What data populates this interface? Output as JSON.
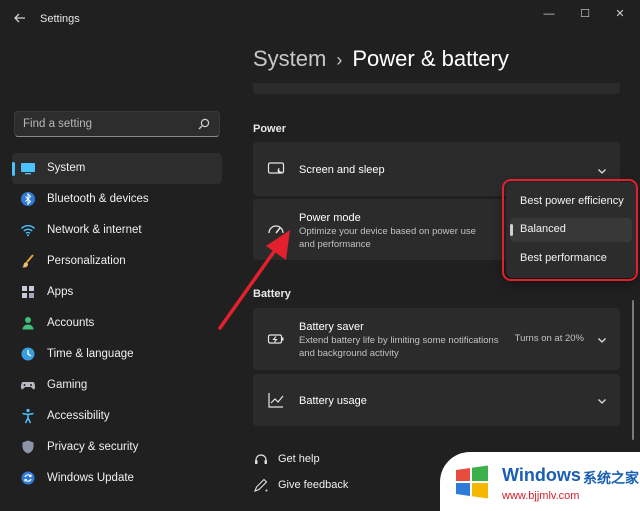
{
  "window": {
    "app_title": "Settings",
    "controls": {
      "minimize": "—",
      "maximize": "☐",
      "close": "✕"
    }
  },
  "search": {
    "placeholder": "Find a setting"
  },
  "sidebar": {
    "items": [
      {
        "label": "System",
        "icon": "monitor-icon",
        "selected": true
      },
      {
        "label": "Bluetooth & devices",
        "icon": "bluetooth-icon"
      },
      {
        "label": "Network & internet",
        "icon": "wifi-icon"
      },
      {
        "label": "Personalization",
        "icon": "brush-icon"
      },
      {
        "label": "Apps",
        "icon": "apps-grid-icon"
      },
      {
        "label": "Accounts",
        "icon": "person-icon"
      },
      {
        "label": "Time & language",
        "icon": "globe-clock-icon"
      },
      {
        "label": "Gaming",
        "icon": "gamepad-icon"
      },
      {
        "label": "Accessibility",
        "icon": "accessibility-icon"
      },
      {
        "label": "Privacy & security",
        "icon": "shield-icon"
      },
      {
        "label": "Windows Update",
        "icon": "update-icon"
      }
    ]
  },
  "header": {
    "section": "System",
    "page": "Power & battery"
  },
  "power": {
    "heading": "Power",
    "screen_sleep": {
      "title": "Screen and sleep"
    },
    "power_mode": {
      "title": "Power mode",
      "description": "Optimize your device based on power use and performance"
    }
  },
  "power_mode_dropdown": {
    "options": [
      "Best power efficiency",
      "Balanced",
      "Best performance"
    ],
    "selected": "Balanced"
  },
  "battery": {
    "heading": "Battery",
    "saver": {
      "title": "Battery saver",
      "description": "Extend battery life by limiting some notifications and background activity",
      "status": "Turns on at 20%"
    },
    "usage": {
      "title": "Battery usage"
    }
  },
  "links": {
    "help": "Get help",
    "feedback": "Give feedback"
  },
  "watermark": {
    "brand": "Windows",
    "brand_cn": "系统之家",
    "url": "www.bjjmlv.com"
  },
  "colors": {
    "accent": "#4cc2ff",
    "highlight": "#e3202e",
    "background": "#202020",
    "card": "#2b2b2b"
  }
}
